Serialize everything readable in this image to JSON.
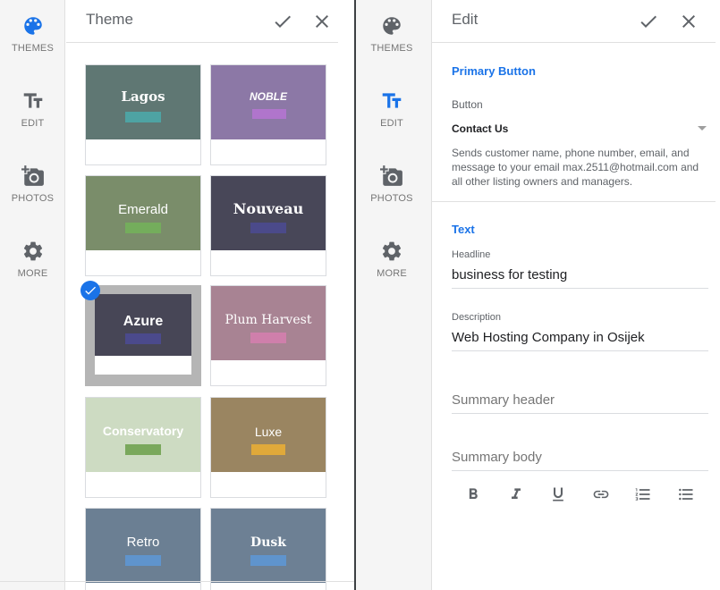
{
  "left_rail": {
    "items": [
      {
        "label": "THEMES",
        "icon": "palette-icon",
        "active": true
      },
      {
        "label": "EDIT",
        "icon": "text-fields-icon",
        "active": false
      },
      {
        "label": "PHOTOS",
        "icon": "add-photo-icon",
        "active": false
      },
      {
        "label": "MORE",
        "icon": "gear-icon",
        "active": false
      }
    ]
  },
  "theme_panel": {
    "title": "Theme",
    "confirm_icon": "check-icon",
    "close_icon": "close-icon",
    "themes": [
      {
        "name": "Lagos",
        "bg": "#5f7773",
        "bar": "#4ea3a3",
        "selected": false
      },
      {
        "name": "NOBLE",
        "bg": "#8c78a6",
        "bar": "#b075cc",
        "selected": false
      },
      {
        "name": "Emerald",
        "bg": "#7a8d6a",
        "bar": "#74ad5c",
        "selected": false
      },
      {
        "name": "Nouveau",
        "bg": "#484758",
        "bar": "#4b4a8a",
        "selected": false
      },
      {
        "name": "Azure",
        "bg": "#474656",
        "bar": "#4b4a8c",
        "selected": true
      },
      {
        "name": "Plum Harvest",
        "bg": "#a88393",
        "bar": "#cf7fab",
        "selected": false
      },
      {
        "name": "Conservatory",
        "bg": "#cddbc2",
        "bar": "#7aa85c",
        "selected": false
      },
      {
        "name": "Luxe",
        "bg": "#9a8561",
        "bar": "#e0a93a",
        "selected": false
      },
      {
        "name": "Retro",
        "bg": "#6b7f93",
        "bar": "#5f94cd",
        "selected": false
      },
      {
        "name": "Dusk",
        "bg": "#6d8094",
        "bar": "#5f94cd",
        "selected": false
      }
    ]
  },
  "right_rail": {
    "items": [
      {
        "label": "THEMES",
        "icon": "palette-icon",
        "active": false
      },
      {
        "label": "EDIT",
        "icon": "text-fields-icon",
        "active": true
      },
      {
        "label": "PHOTOS",
        "icon": "add-photo-icon",
        "active": false
      },
      {
        "label": "MORE",
        "icon": "gear-icon",
        "active": false
      }
    ]
  },
  "edit_panel": {
    "title": "Edit",
    "primary_button_section": "Primary Button",
    "button_label": "Button",
    "button_value": "Contact Us",
    "button_help": "Sends customer name, phone number, email, and message to your email max.2511@hotmail.com and all other listing owners and managers.",
    "text_section": "Text",
    "headline_label": "Headline",
    "headline_value": "business for testing",
    "description_label": "Description",
    "description_value": "Web Hosting Company in Osijek",
    "summary_header_placeholder": "Summary header",
    "summary_body_placeholder": "Summary body",
    "format_tools": [
      "bold-icon",
      "italic-icon",
      "underline-icon",
      "link-icon",
      "numbered-list-icon",
      "bulleted-list-icon"
    ]
  },
  "colors": {
    "accent": "#1a73e8",
    "rail_bg": "#f5f5f5",
    "icon_gray": "#5f6368"
  }
}
